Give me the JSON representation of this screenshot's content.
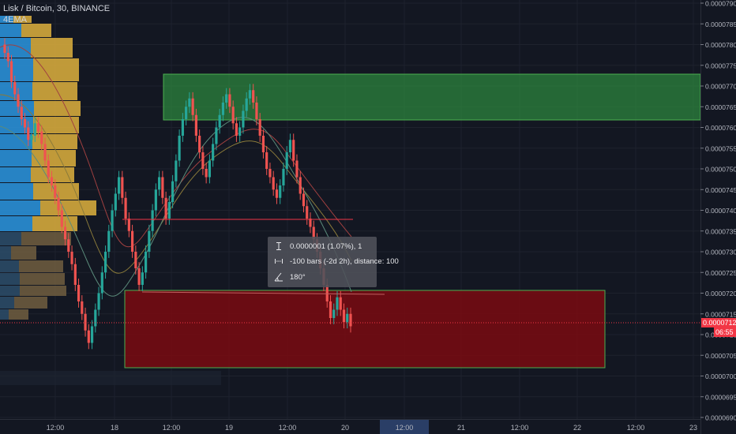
{
  "header": {
    "symbol_line": "Lisk / Bitcoin, 30, BINANCE",
    "indicator": "4EMA"
  },
  "chart_data": {
    "type": "candlestick",
    "ylim": [
      6.9e-06,
      7.905e-06
    ],
    "price_ticks": [
      "0.0000790",
      "0.0000785",
      "0.0000780",
      "0.0000775",
      "0.0000770",
      "0.0000765",
      "0.0000760",
      "0.0000755",
      "0.0000750",
      "0.0000745",
      "0.0000740",
      "0.0000735",
      "0.0000730",
      "0.0000725",
      "0.0000720",
      "0.0000715",
      "0.0000710",
      "0.0000705",
      "0.0000700",
      "0.0000695",
      "0.0000690"
    ],
    "time_ticks": [
      "12:00",
      "18",
      "12:00",
      "19",
      "12:00",
      "20",
      "12:00",
      "21",
      "12:00",
      "22",
      "12:00",
      "23"
    ],
    "highlighted_time_tick": "12:00",
    "last_price": "0.0000712",
    "countdown": "06:55",
    "colors": {
      "background": "#131722",
      "up": "#26a69a",
      "down": "#ef5350",
      "zone_top": "#2e8b3e",
      "zone_bottom": "#7a0a10",
      "horizontal_line": "#f23645",
      "volume_profile_up": "#2a8fd6",
      "volume_profile_down": "#d4a93c"
    }
  },
  "measure_tooltip": {
    "price_line": "0.0000001 (1.07%), 1",
    "bars_line": "-100 bars (-2d 2h), distance: 100",
    "angle_line": "180°"
  }
}
